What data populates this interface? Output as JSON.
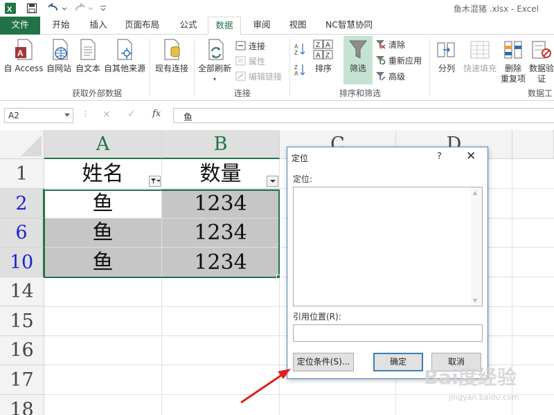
{
  "titlebar": {
    "title": "鱼木混猪 .xlsx - Excel",
    "icons": [
      "excel-logo",
      "save-icon",
      "undo-icon",
      "redo-icon",
      "customize-qat-icon"
    ]
  },
  "tabs": {
    "file": "文件",
    "items": [
      "开始",
      "插入",
      "页面布局",
      "公式",
      "数据",
      "审阅",
      "视图",
      "NC智慧协同"
    ],
    "active": "数据"
  },
  "ribbon": {
    "external": {
      "group": "获取外部数据",
      "access": "自 Access",
      "web": "自网站",
      "text": "自文本",
      "other": "自其他来源",
      "existing": "现有连接"
    },
    "connections": {
      "group": "连接",
      "refresh_all": "全部刷新",
      "connections": "连接",
      "properties": "属性",
      "edit_links": "编辑链接"
    },
    "sort_filter": {
      "group": "排序和筛选",
      "sort": "排序",
      "filter": "筛选",
      "clear": "清除",
      "reapply": "重新应用",
      "advanced": "高级"
    },
    "data_tools": {
      "group": "数据工",
      "text_to_columns": "分列",
      "flash_fill": "快速填充",
      "remove_duplicates_1": "删除",
      "remove_duplicates_2": "重复项",
      "validation_1": "数据验",
      "validation_2": "证"
    }
  },
  "formula_bar": {
    "name_box": "A2",
    "fx": "fx",
    "value": "鱼"
  },
  "sheet": {
    "columns": [
      "A",
      "B",
      "C",
      "D"
    ],
    "rows": [
      "1",
      "2",
      "6",
      "10",
      "14",
      "15",
      "16",
      "17",
      "18"
    ],
    "header_a": "姓名",
    "header_b": "数量",
    "data": [
      {
        "a": "鱼",
        "b": "1234"
      },
      {
        "a": "鱼",
        "b": "1234"
      },
      {
        "a": "鱼",
        "b": "1234"
      }
    ]
  },
  "dialog": {
    "title": "定位",
    "help": "?",
    "close": "✕",
    "goto_label": "定位:",
    "reference_label": "引用位置(R):",
    "special_button": "定位条件(S)...",
    "ok_button": "确定",
    "cancel_button": "取消"
  },
  "watermark": {
    "text": "Bai度经验",
    "url": "jingyan.baidu.com"
  },
  "colors": {
    "excel_green": "#217346",
    "row_selected_blue": "#1f1fd1",
    "cell_shade": "#c6c6c6",
    "arrow_red": "#e0201f"
  }
}
